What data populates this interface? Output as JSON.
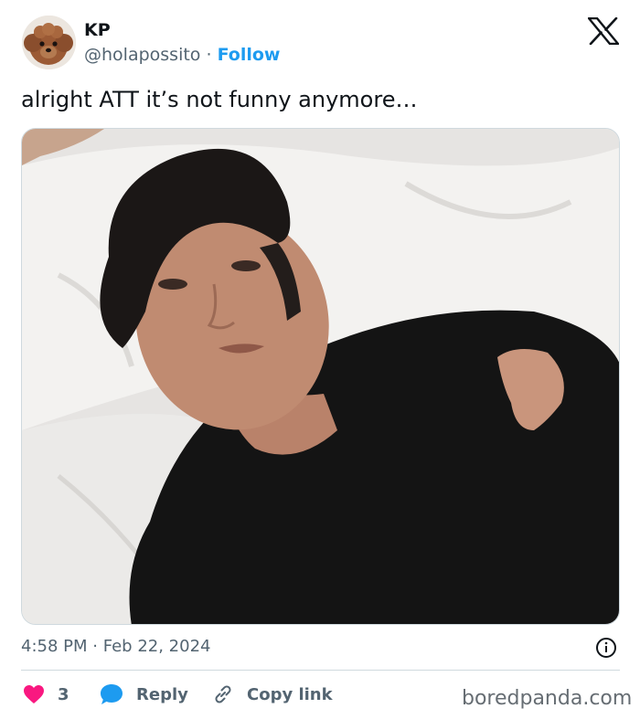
{
  "author": {
    "name": "KP",
    "handle": "@holapossito",
    "separator": "·",
    "follow_label": "Follow"
  },
  "tweet": {
    "text": "alright ATT it’s not funny anymore…",
    "time": "4:58 PM",
    "date_separator": "·",
    "date": "Feb 22, 2024"
  },
  "actions": {
    "like_count": "3",
    "reply_label": "Reply",
    "copy_link_label": "Copy link"
  },
  "watermark": "boredpanda.com",
  "colors": {
    "accent": "#1d9bf0",
    "like": "#f91880",
    "secondary_text": "#536471",
    "border": "#cfd9de"
  },
  "icons": [
    "x-logo-icon",
    "info-icon",
    "heart-icon",
    "reply-bubble-icon",
    "link-icon"
  ]
}
